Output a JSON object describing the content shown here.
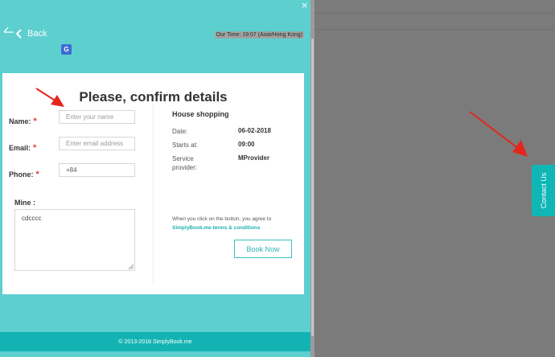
{
  "widget": {
    "close_glyph": "×",
    "back_label": "Back",
    "our_time": "Our Time: 19:07 (Asia/Hong Kong)",
    "translate_glyph": "G"
  },
  "form": {
    "title": "Please, confirm details",
    "name_label": "Name:",
    "name_placeholder": "Enter your name",
    "email_label": "Email:",
    "email_placeholder": "Enter email address",
    "phone_label": "Phone:",
    "phone_value": "+84",
    "required_mark": "*",
    "mine_label": "Mine :",
    "mine_value": "cdcccc"
  },
  "details": {
    "service_title": "House shopping",
    "date_label": "Date:",
    "date_value": "06-02-2018",
    "starts_label": "Starts at:",
    "starts_value": "09:00",
    "provider_label_line1": "Service",
    "provider_label_line2": "provider:",
    "provider_value": "MProvider",
    "agree_text": "When you click on the button, you agree to",
    "terms_link": "SimplyBook.me terms & conditions",
    "book_button": "Book Now"
  },
  "footer": {
    "copyright": "© 2013-2018 SimplyBook.me"
  },
  "contact_tab": {
    "label": "Contact Us"
  },
  "colors": {
    "panel_bg": "#5ecfcf",
    "footer_bg": "#14b3b3",
    "accent": "#2eb2b2",
    "required": "#e23c3c",
    "annotation_arrow": "#e5261c"
  }
}
